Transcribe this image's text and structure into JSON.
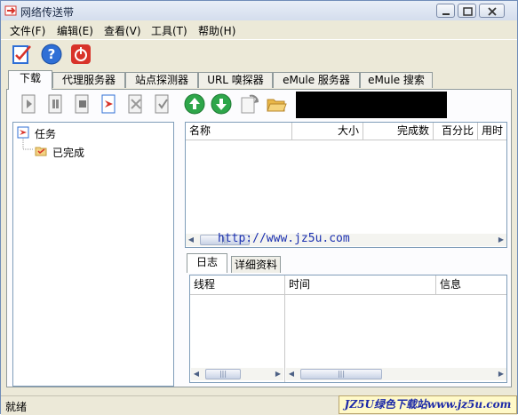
{
  "window": {
    "title": "网络传送带"
  },
  "menu": [
    "文件(F)",
    "编辑(E)",
    "查看(V)",
    "工具(T)",
    "帮助(H)"
  ],
  "main_tabs": [
    "下载",
    "代理服务器",
    "站点探测器",
    "URL 嗅探器",
    "eMule 服务器",
    "eMule 搜索"
  ],
  "tree": {
    "root": "任务",
    "child": "已完成"
  },
  "download_columns": [
    "名称",
    "大小",
    "完成数",
    "百分比",
    "用时"
  ],
  "url_text": "http://www.jz5u.com",
  "log_tabs": [
    "日志",
    "详细资料"
  ],
  "log_columns": [
    "线程",
    "时间",
    "信息"
  ],
  "status": {
    "text": "就绪"
  },
  "watermark": "JZ5U绿色下载站www.jz5u.com",
  "colors": {
    "accent_blue": "#2f6fd6",
    "green_arrow": "#2ea64a",
    "red": "#d8332a",
    "folder": "#e9b748"
  }
}
